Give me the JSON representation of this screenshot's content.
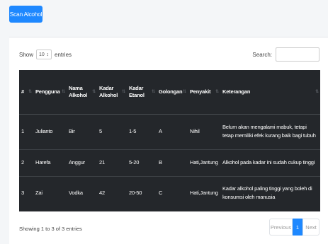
{
  "scan_button": "Scan Alcohol",
  "length_menu": {
    "prefix": "Show",
    "value": "10",
    "suffix": "entries"
  },
  "search": {
    "label": "Search:",
    "value": ""
  },
  "table": {
    "columns": [
      "#",
      "Pengguna",
      "Nama Alkohol",
      "Kadar Alkohol",
      "Kadar Etanol",
      "Golongan",
      "Penyakit",
      "Keterangan"
    ],
    "rows": [
      [
        "1",
        "Julianto",
        "Bir",
        "5",
        "1-5",
        "A",
        "Nihil",
        "Belum akan mengalami mabuk, tetapi tetap memiliki efek kurang baik bagi tubuh"
      ],
      [
        "2",
        "Harefa",
        "Anggur",
        "21",
        "5-20",
        "B",
        "Hati,Jantung",
        "Alkohol pada kadar ini sudah cukup tinggi"
      ],
      [
        "3",
        "Zai",
        "Vodka",
        "42",
        "20-50",
        "C",
        "Hati,Jantung",
        "Kadar alkohol paling tinggi yang boleh di konsumsi oleh manusia"
      ]
    ]
  },
  "info": "Showing 1 to 3 of 3 entries",
  "pagination": {
    "previous": "Previous",
    "current": "1",
    "next": "Next"
  },
  "colors": {
    "primary": "#1e88ff",
    "table_bg": "#24272b"
  }
}
